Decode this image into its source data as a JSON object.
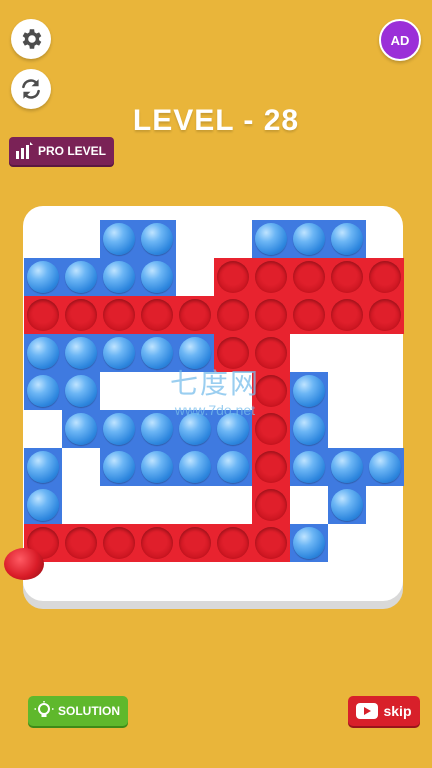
{
  "header": {
    "level_title": "LEVEL - 28",
    "ad_label": "AD",
    "pro_level_label": "PRO LEVEL"
  },
  "watermark": {
    "chinese": "七度网",
    "url": "www.7do.net"
  },
  "footer": {
    "solution_label": "SOLUTION",
    "skip_label": "skip"
  },
  "colors": {
    "background": "#e9b53a",
    "blue_bubble": "#3f7ae0",
    "red_bubble": "#e8232f",
    "board": "#ffffff"
  },
  "board": {
    "legend": "B = blue unpopped bubble, R = red popped bubble, . = wall",
    "rows": [
      "..BB..BBB.",
      "BBBB.RRRRR",
      "RRRRRRRRRR",
      "BBBBBRR...",
      "BB....RB..",
      ".BBBBBRB..",
      "B.BBBBRBBB",
      "B.....R.B.",
      "RRRRRRRB.."
    ]
  }
}
